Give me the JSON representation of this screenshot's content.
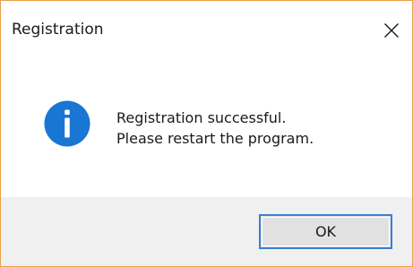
{
  "window": {
    "title": "Registration",
    "close_icon": "close-icon"
  },
  "message": {
    "icon": "info-icon",
    "lines": [
      "Registration successful.",
      "Please restart the program."
    ]
  },
  "buttons": {
    "ok_label": "OK"
  },
  "colors": {
    "window_border": "#e8a24a",
    "footer_background": "#f0f0f0",
    "info_icon": "#1976d2",
    "button_focus_border": "#3c7fd3",
    "button_background": "#e1e1e1"
  }
}
